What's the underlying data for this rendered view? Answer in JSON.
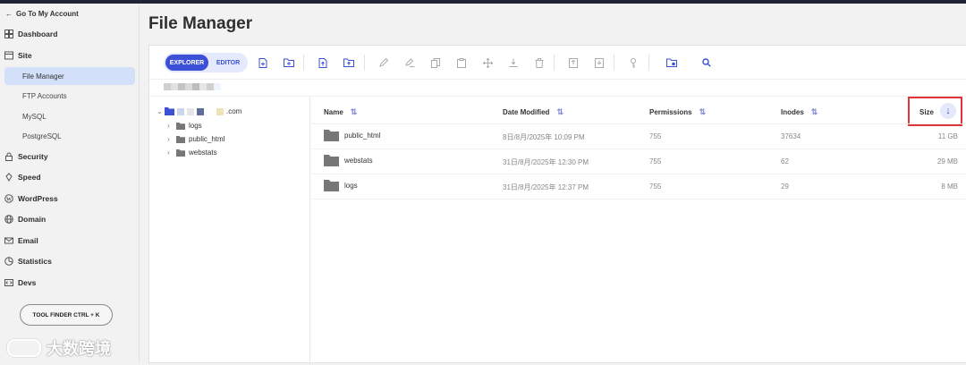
{
  "sidebar": {
    "back_label": "Go To My Account",
    "items": [
      {
        "label": "Dashboard",
        "icon": "dashboard-icon"
      },
      {
        "label": "Site",
        "icon": "site-icon"
      },
      {
        "label": "Security",
        "icon": "lock-icon"
      },
      {
        "label": "Speed",
        "icon": "speed-icon"
      },
      {
        "label": "WordPress",
        "icon": "wordpress-icon"
      },
      {
        "label": "Domain",
        "icon": "globe-icon"
      },
      {
        "label": "Email",
        "icon": "mail-icon"
      },
      {
        "label": "Statistics",
        "icon": "chart-icon"
      },
      {
        "label": "Devs",
        "icon": "code-icon"
      }
    ],
    "site_subitems": [
      "File Manager",
      "FTP Accounts",
      "MySQL",
      "PostgreSQL"
    ],
    "active_subitem": "File Manager",
    "tool_finder": "TOOL FINDER CTRL + K"
  },
  "watermark": "大数跨境",
  "page": {
    "title": "File Manager"
  },
  "toolbar": {
    "explorer": "EXPLORER",
    "editor": "EDITOR",
    "active_mode": "EXPLORER"
  },
  "tree": {
    "root_label": ".com",
    "children": [
      "logs",
      "public_html",
      "webstats"
    ]
  },
  "table": {
    "headers": {
      "name": "Name",
      "date": "Date Modified",
      "perm": "Permissions",
      "inodes": "Inodes",
      "size": "Size"
    },
    "sort": {
      "column": "Size",
      "direction": "desc"
    },
    "rows": [
      {
        "name": "public_html",
        "date": "8日/8月/2025年 10:09 PM",
        "perm": "755",
        "inodes": "37634",
        "size": "11 GB"
      },
      {
        "name": "webstats",
        "date": "31日/8月/2025年 12:30 PM",
        "perm": "755",
        "inodes": "62",
        "size": "29 MB"
      },
      {
        "name": "logs",
        "date": "31日/8月/2025年 12:37 PM",
        "perm": "755",
        "inodes": "29",
        "size": "8 MB"
      }
    ]
  },
  "colors": {
    "accent": "#3b50d6",
    "active_bg": "#d2e0fa",
    "highlight": "#e0353a"
  }
}
